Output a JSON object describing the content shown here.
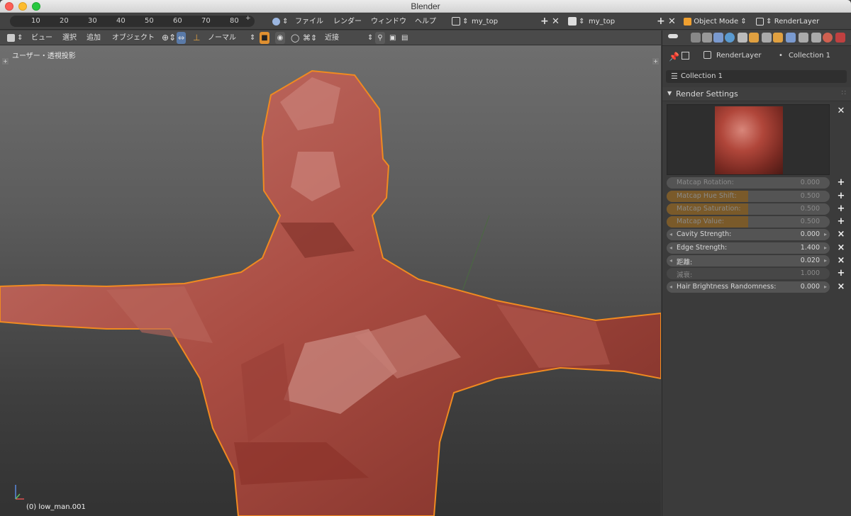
{
  "window": {
    "title": "Blender"
  },
  "topbar": {
    "ruler_ticks": [
      "10",
      "20",
      "30",
      "40",
      "50",
      "60",
      "70",
      "80"
    ],
    "menu": [
      "ファイル",
      "レンダー",
      "ウィンドウ",
      "ヘルプ"
    ],
    "screen_name": "my_top",
    "scene_name": "my_top",
    "mode": "Object Mode",
    "render_layer": "RenderLayer"
  },
  "viewport_header": {
    "menu": [
      "ビュー",
      "選択",
      "追加",
      "オブジェクト"
    ],
    "pivot": "ノーマル",
    "snap": "近接"
  },
  "viewport": {
    "view_label": "ユーザー・透視投影",
    "object_label": "(0) low_man.001"
  },
  "properties": {
    "breadcrumb_layer": "RenderLayer",
    "breadcrumb_collection": "Collection 1",
    "collection_field": "Collection 1",
    "section_title": "Render Settings",
    "fields": [
      {
        "label": "Matcap Rotation:",
        "value": "0.000",
        "fill": 0.0,
        "disabled": true,
        "btn": "+"
      },
      {
        "label": "Matcap Hue Shift:",
        "value": "0.500",
        "fill": 0.5,
        "disabled": true,
        "btn": "+"
      },
      {
        "label": "Matcap Saturation:",
        "value": "0.500",
        "fill": 0.5,
        "disabled": true,
        "btn": "+"
      },
      {
        "label": "Matcap Value:",
        "value": "0.500",
        "fill": 0.5,
        "disabled": true,
        "btn": "+"
      },
      {
        "label": "Cavity Strength:",
        "value": "0.000",
        "fill": 0.0,
        "disabled": false,
        "btn": "×"
      },
      {
        "label": "Edge Strength:",
        "value": "1.400",
        "fill": 0.0,
        "disabled": false,
        "btn": "×"
      },
      {
        "label": "距離:",
        "value": "0.020",
        "fill": 0.0,
        "disabled": false,
        "btn": "×"
      },
      {
        "label": "減衰:",
        "value": "1.000",
        "fill": 0.0,
        "disabled": true,
        "btn": "+"
      },
      {
        "label": "Hair Brightness Randomness:",
        "value": "0.000",
        "fill": 0.0,
        "disabled": false,
        "btn": "×"
      }
    ]
  },
  "colors": {
    "accent": "#f0a030",
    "selection_outline": "#f08a20",
    "mesh": "#b65a4d"
  }
}
